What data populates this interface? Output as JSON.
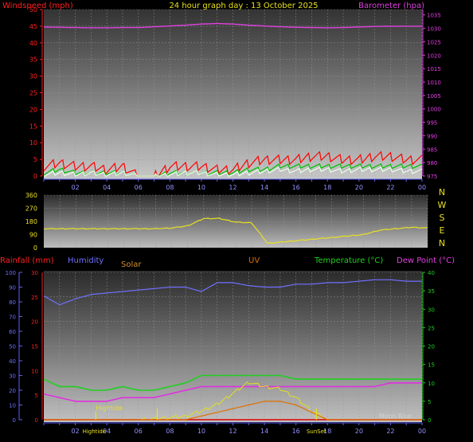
{
  "title": "24 hour graph day : 13 October 2025",
  "colors": {
    "wind": "#ff2020",
    "gust": "#ff0000",
    "avgwind": "#00c000",
    "pressure": "#e040e0",
    "direction": "#e8e020",
    "humidity": "#7070ff",
    "temperature": "#20d020",
    "dewpoint": "#e030e0",
    "solar": "#e0e020",
    "uv": "#e07000",
    "rain": "#e00000",
    "grid": "#9a9a9a",
    "text_yellow": "#e8e020",
    "text_green": "#20d020",
    "text_blue": "#7070ff"
  },
  "chart_data": [
    {
      "type": "line",
      "panel": "wind-pressure",
      "left_axis_label": "Windspeed (mph)",
      "right_axis_label": "Barometer (hpa)",
      "x_ticks": [
        "02",
        "04",
        "06",
        "08",
        "10",
        "12",
        "14",
        "16",
        "18",
        "20",
        "22",
        "00"
      ],
      "left_ticks": [
        "0",
        "5",
        "10",
        "15",
        "20",
        "25",
        "30",
        "35",
        "40",
        "45",
        "50"
      ],
      "right_ticks": [
        "975",
        "980",
        "985",
        "990",
        "995",
        "1000",
        "1005",
        "1010",
        "1015",
        "1020",
        "1025",
        "1030",
        "1035"
      ],
      "ylim_left": [
        0,
        50
      ],
      "ylim_right": [
        975,
        1037
      ],
      "x_hours": [
        0,
        1,
        2,
        3,
        4,
        5,
        6,
        7,
        8,
        9,
        10,
        11,
        12,
        13,
        14,
        15,
        16,
        17,
        18,
        19,
        20,
        21,
        22,
        23,
        24
      ],
      "series": [
        {
          "key": "pressure",
          "axis": "right",
          "values": [
            1030.5,
            1030.4,
            1030.3,
            1030.2,
            1030.2,
            1030.3,
            1030.3,
            1030.6,
            1030.9,
            1031.2,
            1031.6,
            1031.8,
            1031.6,
            1031.2,
            1030.9,
            1030.6,
            1030.4,
            1030.3,
            1030.2,
            1030.3,
            1030.5,
            1030.7,
            1030.8,
            1030.8,
            1030.8
          ]
        },
        {
          "key": "gust",
          "axis": "left",
          "values": [
            3,
            4,
            3,
            3,
            2,
            3,
            0,
            0,
            3,
            3,
            3,
            2,
            2,
            4,
            5,
            5,
            5,
            6,
            6,
            5,
            5,
            6,
            6,
            5,
            5
          ]
        },
        {
          "key": "avgwind",
          "axis": "left",
          "values": [
            1,
            2,
            1,
            1,
            1,
            1,
            0,
            0,
            1,
            1,
            1,
            1,
            1,
            2,
            2,
            3,
            3,
            3,
            3,
            3,
            3,
            3,
            3,
            3,
            3
          ]
        },
        {
          "key": "wind",
          "axis": "left",
          "values": [
            0.5,
            1,
            0.5,
            1,
            0.5,
            1,
            0,
            0,
            0.5,
            1,
            1,
            0.5,
            0.5,
            1,
            1.5,
            2,
            1.5,
            2,
            2,
            1.5,
            2,
            2,
            2,
            1.5,
            1.5
          ]
        }
      ]
    },
    {
      "type": "line",
      "panel": "wind-direction",
      "left_ticks": [
        "0",
        "90",
        "180",
        "270",
        "360"
      ],
      "compass_labels": [
        "N",
        "W",
        "S",
        "E",
        "N"
      ],
      "ylim": [
        0,
        360
      ],
      "x_hours": [
        0,
        1,
        2,
        3,
        4,
        5,
        6,
        7,
        8,
        9,
        10,
        11,
        12,
        13,
        14,
        15,
        16,
        17,
        18,
        19,
        20,
        21,
        22,
        23,
        24
      ],
      "values": [
        130,
        130,
        130,
        130,
        130,
        130,
        130,
        130,
        135,
        150,
        200,
        200,
        175,
        170,
        30,
        40,
        50,
        60,
        70,
        80,
        90,
        120,
        130,
        140,
        135
      ]
    },
    {
      "type": "line",
      "panel": "weather",
      "labels": {
        "rain": "Rainfall (mm)",
        "humidity": "Humidity",
        "solar": "Solar",
        "uv": "UV",
        "temperature": "Temperature (°C)",
        "dewpoint": "Dew Point (°C)"
      },
      "humidity_ticks": [
        "0",
        "10",
        "20",
        "30",
        "40",
        "50",
        "60",
        "70",
        "80",
        "90",
        "100"
      ],
      "rain_ticks": [
        "0",
        "5",
        "10",
        "15",
        "20",
        "25",
        "30"
      ],
      "temp_ticks": [
        "0",
        "5",
        "10",
        "15",
        "20",
        "25",
        "30",
        "35",
        "40"
      ],
      "x_ticks": [
        "02",
        "04",
        "06",
        "08",
        "10",
        "12",
        "14",
        "16",
        "18",
        "20",
        "22",
        "00"
      ],
      "ylim_humidity": [
        0,
        100
      ],
      "ylim_temp": [
        0,
        40
      ],
      "annotations": {
        "hightide_mid": "Hightide",
        "hightide_axis": "Hightide",
        "sunset": "SunSet",
        "moonrise": "Moon Rise"
      },
      "x_hours": [
        0,
        1,
        2,
        3,
        4,
        5,
        6,
        7,
        8,
        9,
        10,
        11,
        12,
        13,
        14,
        15,
        16,
        17,
        18,
        19,
        20,
        21,
        22,
        23,
        24
      ],
      "series": [
        {
          "key": "humidity",
          "values": [
            84,
            78,
            82,
            85,
            86,
            87,
            88,
            89,
            90,
            90,
            87,
            93,
            93,
            91,
            90,
            90,
            92,
            92,
            93,
            93,
            94,
            95,
            95,
            94,
            94
          ]
        },
        {
          "key": "temperature",
          "values": [
            11,
            9,
            9,
            8,
            8,
            9,
            8,
            8,
            9,
            10,
            12,
            12,
            12,
            12,
            12,
            12,
            11,
            11,
            11,
            11,
            11,
            11,
            11,
            11,
            11
          ]
        },
        {
          "key": "dewpoint",
          "values": [
            7,
            6,
            5,
            5,
            5,
            6,
            6,
            6,
            7,
            8,
            9,
            9,
            9,
            9,
            9,
            9,
            9,
            9,
            9,
            9,
            9,
            9,
            10,
            10,
            10
          ]
        },
        {
          "key": "solar",
          "values": [
            0,
            0,
            0,
            0,
            0,
            0,
            0,
            2,
            5,
            8,
            20,
            35,
            60,
            85,
            75,
            70,
            50,
            20,
            0,
            0,
            0,
            0,
            0,
            0,
            0
          ]
        },
        {
          "key": "uv",
          "values": [
            0,
            0,
            0,
            0,
            0,
            0,
            0,
            0,
            0,
            0,
            1,
            2,
            3,
            4,
            5,
            5,
            4,
            2,
            0,
            0,
            0,
            0,
            0,
            0,
            0
          ]
        }
      ]
    }
  ]
}
